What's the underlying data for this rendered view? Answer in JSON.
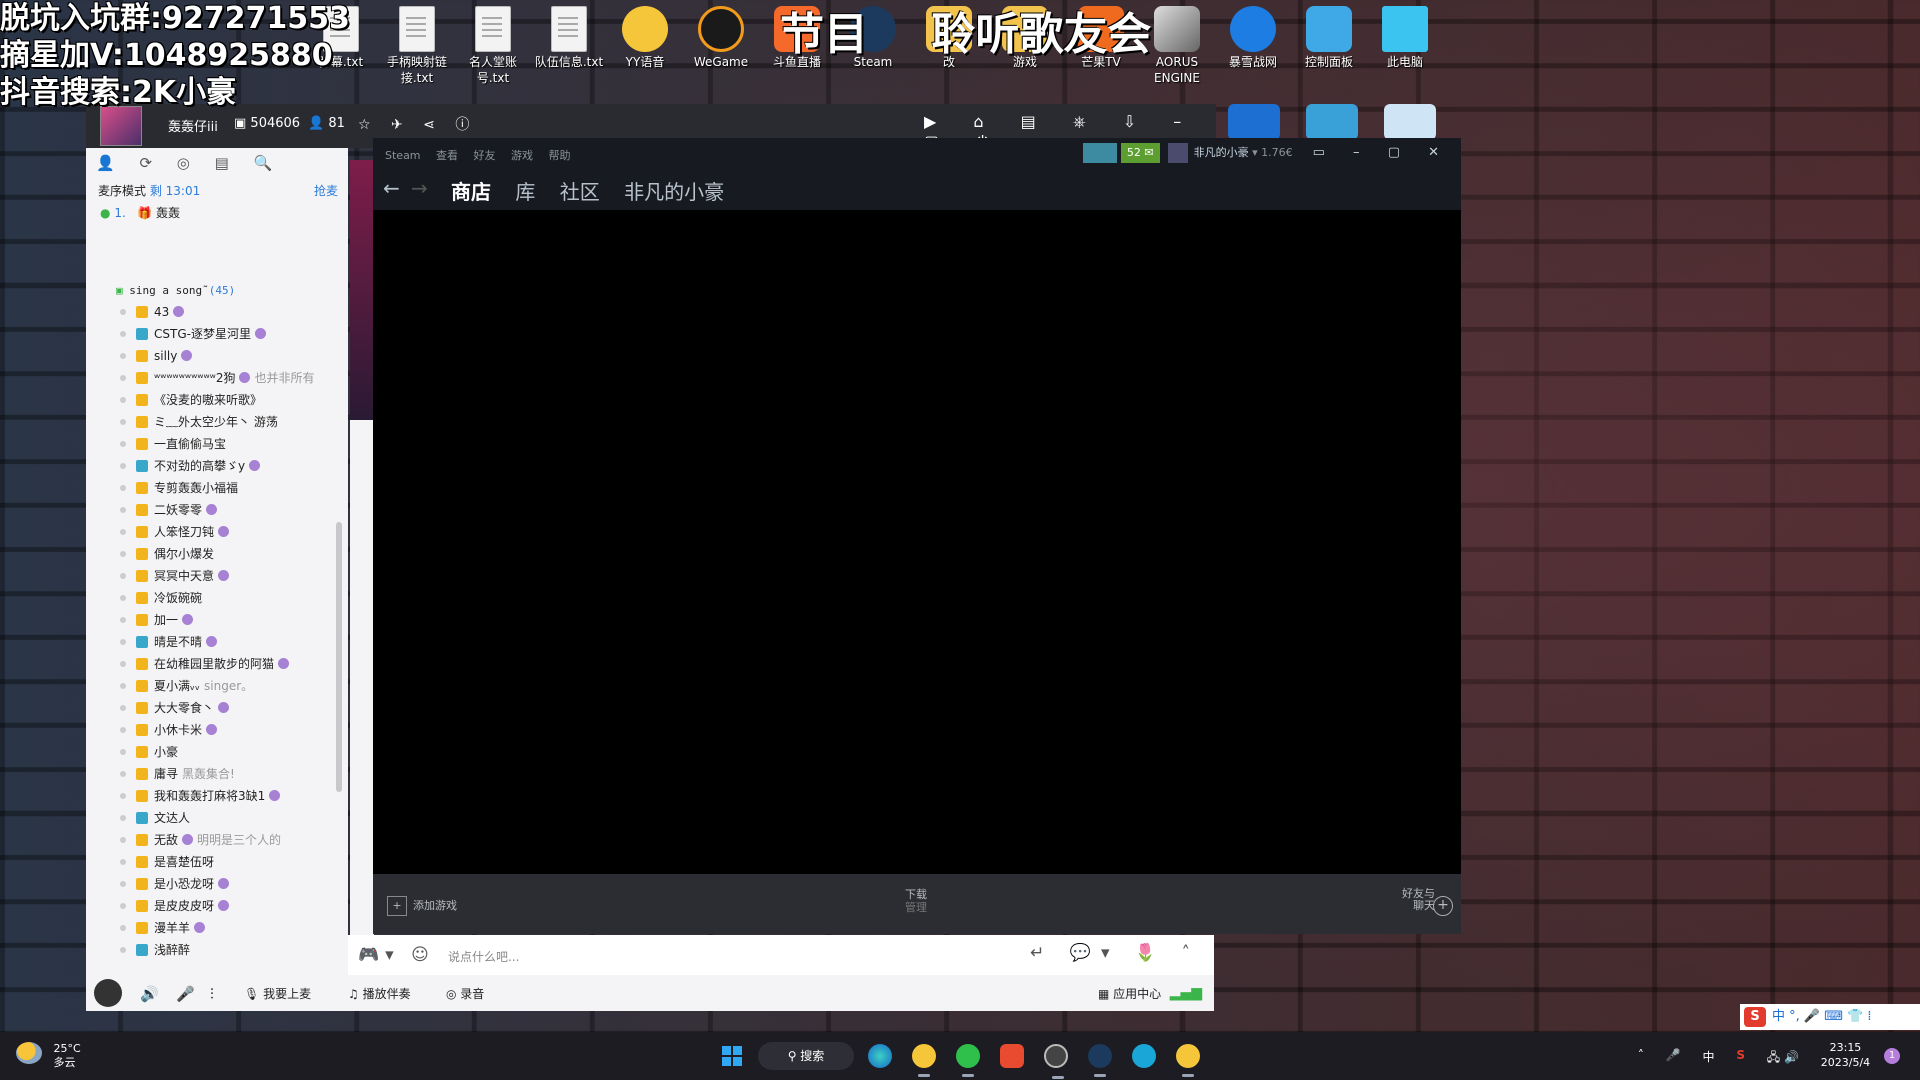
{
  "overlay": {
    "lines": [
      "脱坑入坑群:927271553",
      "摘星加V:1048925880",
      "抖音搜索:2K小豪"
    ],
    "banner": [
      "节目",
      "聆听歌友会"
    ]
  },
  "desktop": {
    "icons": [
      {
        "label": "弹幕.txt",
        "icon": "text-file-icon"
      },
      {
        "label": "手柄映射链接.txt",
        "icon": "text-file-icon"
      },
      {
        "label": "名人堂账号.txt",
        "icon": "text-file-icon"
      },
      {
        "label": "队伍信息.txt",
        "icon": "text-file-icon"
      },
      {
        "label": "YY语音",
        "icon": "yy-icon"
      },
      {
        "label": "WeGame",
        "icon": "wegame-icon"
      },
      {
        "label": "斗鱼直播",
        "icon": "douyu-icon"
      },
      {
        "label": "Steam",
        "icon": "steam-icon"
      },
      {
        "label": "改",
        "icon": "folder-icon"
      },
      {
        "label": "游戏",
        "icon": "folder-icon"
      },
      {
        "label": "芒果TV",
        "icon": "mango-icon"
      },
      {
        "label": "AORUS ENGINE",
        "icon": "aorus-icon"
      },
      {
        "label": "暴雪战网",
        "icon": "battlenet-icon"
      },
      {
        "label": "控制面板",
        "icon": "control-panel-icon"
      },
      {
        "label": "此电脑",
        "icon": "computer-icon"
      }
    ]
  },
  "yy": {
    "channel_name": "轰轰仔iii",
    "room_id": "504606",
    "online": "81",
    "mode_label": "麦序模式",
    "mode_time": "剩 13:01",
    "grab_mic": "抢麦",
    "queue": [
      {
        "index": "1.",
        "name": "轰轰"
      }
    ],
    "sub_channel": {
      "name": "sing a song˜",
      "count": "(45)"
    },
    "users": [
      {
        "name": "43",
        "note": ""
      },
      {
        "name": "CSTG-逐梦星河里",
        "note": ""
      },
      {
        "name": "silly",
        "note": ""
      },
      {
        "name": "ʷʷʷʷʷʷʷʷʷʷ2狗",
        "note": "也并非所有"
      },
      {
        "name": "《没麦的嗷来听歌》",
        "note": ""
      },
      {
        "name": "ミ﹏外太空少年丶 游荡",
        "note": ""
      },
      {
        "name": "一直偷偷马宝",
        "note": ""
      },
      {
        "name": "不对劲的高攀ゞy",
        "note": ""
      },
      {
        "name": "专剪轰轰小福福",
        "note": ""
      },
      {
        "name": "二妖零零",
        "note": ""
      },
      {
        "name": "人笨怪刀钝",
        "note": ""
      },
      {
        "name": "偶尔小爆发",
        "note": ""
      },
      {
        "name": "冥冥中天意",
        "note": ""
      },
      {
        "name": "冷饭碗碗",
        "note": ""
      },
      {
        "name": "加一",
        "note": ""
      },
      {
        "name": "晴是不晴",
        "note": ""
      },
      {
        "name": "在幼稚园里散步的阿猫",
        "note": ""
      },
      {
        "name": "夏小满ᵥᵥ",
        "note": "singer。"
      },
      {
        "name": "大大零食丶",
        "note": ""
      },
      {
        "name": "小休卡米",
        "note": ""
      },
      {
        "name": "小豪",
        "note": ""
      },
      {
        "name": "庸寻",
        "note": "黑轰集合!"
      },
      {
        "name": "我和轰轰打麻将3缺1",
        "note": ""
      },
      {
        "name": "文达人",
        "note": ""
      },
      {
        "name": "无敌",
        "note": "明明是三个人的"
      },
      {
        "name": "是喜楚伍呀",
        "note": ""
      },
      {
        "name": "是小恐龙呀",
        "note": ""
      },
      {
        "name": "是皮皮皮呀",
        "note": ""
      },
      {
        "name": "漫羊羊",
        "note": ""
      },
      {
        "name": "浅醉醉",
        "note": ""
      }
    ],
    "input_placeholder": "说点什么吧...",
    "bottom": {
      "mic_up": "我要上麦",
      "accompany": "播放伴奏",
      "record": "录音",
      "app_center": "应用中心"
    }
  },
  "steam": {
    "menu": [
      "Steam",
      "查看",
      "好友",
      "游戏",
      "帮助"
    ],
    "messages": "52 ✉",
    "account": "非凡的小豪",
    "balance": "1.76€",
    "tabs": [
      "商店",
      "库",
      "社区",
      "非凡的小豪"
    ],
    "add_game": "添加游戏",
    "downloads": "下载",
    "downloads_sub": "管理",
    "friends_chat": [
      "好友与",
      "聊天"
    ]
  },
  "taskbar": {
    "weather_temp": "25°C",
    "weather_desc": "多云",
    "search_label": "搜索",
    "ime_lang": "中",
    "time": "23:15",
    "date": "2023/5/4",
    "notifications": "1"
  },
  "ime_bar": {
    "label": "中 °, 🎤 ⌨ 👕 ⁞"
  }
}
